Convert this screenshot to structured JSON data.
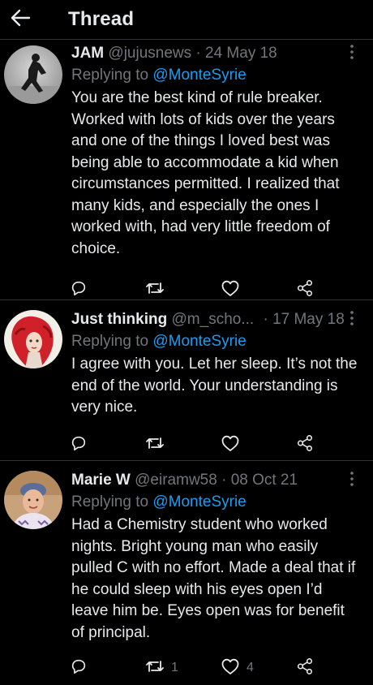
{
  "header": {
    "back_icon": "arrow-left-icon",
    "title": "Thread"
  },
  "tweets": [
    {
      "name": "JAM",
      "handle": "@jujusnews",
      "separator": "·",
      "date": "24 May 18",
      "replying_prefix": "Replying to ",
      "replying_to": "@MonteSyrie",
      "text": "You are the best kind of rule breaker. Worked with lots of kids over the years and one of the things I loved best was being able to accommodate a kid when circumstances permitted. I realized that many kids, and especially the ones I worked with, had very little freedom of choice.",
      "retweets": "",
      "likes": ""
    },
    {
      "name": "Just thinking",
      "handle": "@m_scho...",
      "separator": "·",
      "date": "17 May 18",
      "replying_prefix": "Replying to ",
      "replying_to": "@MonteSyrie",
      "text": "I agree with you. Let her sleep. It’s not the end of the world. Your understanding is very nice.",
      "retweets": "",
      "likes": ""
    },
    {
      "name": "Marie W",
      "handle": "@eiramw58",
      "separator": "·",
      "date": "08 Oct 21",
      "replying_prefix": "Replying to ",
      "replying_to": "@MonteSyrie",
      "text": "Had a Chemistry student who worked nights. Bright young man who easily pulled C with no effort. Made a deal that if he could sleep with his eyes open I’d leave him be. Eyes open was for benefit of principal.",
      "retweets": "1",
      "likes": "4"
    }
  ],
  "colors": {
    "background": "#000000",
    "text": "#e7e9ea",
    "muted": "#71767b",
    "link": "#1d9bf0",
    "divider": "#2f3336"
  },
  "icons": [
    "arrow-left-icon",
    "more-vertical-icon",
    "reply-icon",
    "retweet-icon",
    "like-icon",
    "share-icon"
  ]
}
